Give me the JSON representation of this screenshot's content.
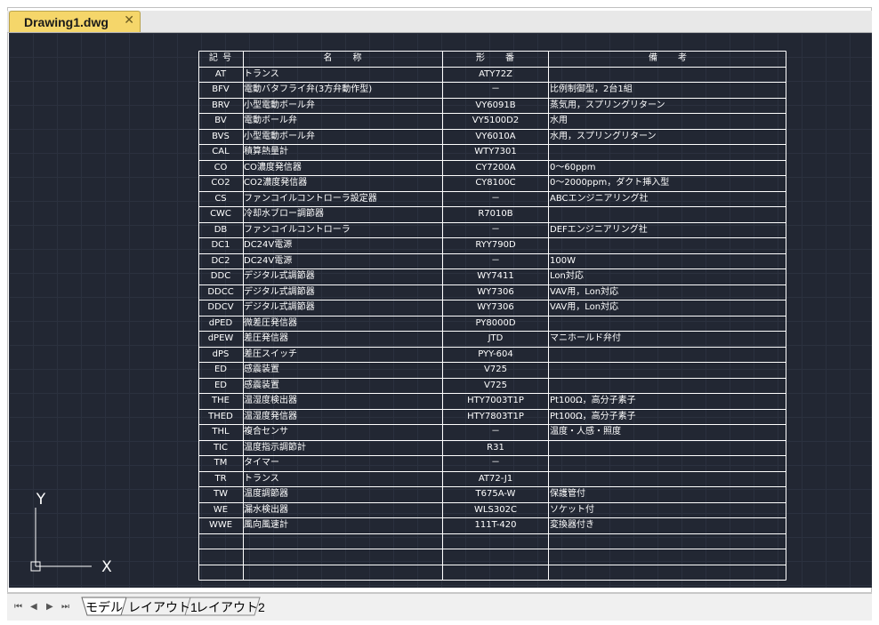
{
  "document_tab": {
    "title": "Drawing1.dwg",
    "close_glyph": "✕"
  },
  "schedule": {
    "headers": {
      "code": "記 号",
      "name": "名　　称",
      "model": "形　　番",
      "note": "備　　考"
    },
    "rows": [
      {
        "code": "AT",
        "name": "トランス",
        "model": "ATY72Z",
        "note": ""
      },
      {
        "code": "BFV",
        "name": "電動バタフライ弁(3方弁動作型)",
        "model": "－",
        "note": "比例制御型，2台1組"
      },
      {
        "code": "BRV",
        "name": "小型電動ボール弁",
        "model": "VY6091B",
        "note": "蒸気用，スプリングリターン"
      },
      {
        "code": "BV",
        "name": "電動ボール弁",
        "model": "VY5100D2",
        "note": "水用"
      },
      {
        "code": "BVS",
        "name": "小型電動ボール弁",
        "model": "VY6010A",
        "note": "水用，スプリングリターン"
      },
      {
        "code": "CAL",
        "name": "積算熱量計",
        "model": "WTY7301",
        "note": ""
      },
      {
        "code": "CO",
        "name": "CO濃度発信器",
        "model": "CY7200A",
        "note": "0～60ppm"
      },
      {
        "code": "CO2",
        "name": "CO2濃度発信器",
        "model": "CY8100C",
        "note": "0～2000ppm，ダクト挿入型"
      },
      {
        "code": "CS",
        "name": "ファンコイルコントローラ設定器",
        "model": "－",
        "note": "ABCエンジニアリング社"
      },
      {
        "code": "CWC",
        "name": "冷却水ブロー調節器",
        "model": "R7010B",
        "note": ""
      },
      {
        "code": "DB",
        "name": "ファンコイルコントローラ",
        "model": "－",
        "note": "DEFエンジニアリング社"
      },
      {
        "code": "DC1",
        "name": "DC24V電源",
        "model": "RYY790D",
        "note": ""
      },
      {
        "code": "DC2",
        "name": "DC24V電源",
        "model": "－",
        "note": "100W"
      },
      {
        "code": "DDC",
        "name": "デジタル式調節器",
        "model": "WY7411",
        "note": "Lon対応"
      },
      {
        "code": "DDCC",
        "name": "デジタル式調節器",
        "model": "WY7306",
        "note": "VAV用，Lon対応"
      },
      {
        "code": "DDCV",
        "name": "デジタル式調節器",
        "model": "WY7306",
        "note": "VAV用，Lon対応"
      },
      {
        "code": "dPED",
        "name": "微差圧発信器",
        "model": "PY8000D",
        "note": ""
      },
      {
        "code": "dPEW",
        "name": "差圧発信器",
        "model": "JTD",
        "note": "マニホールド弁付"
      },
      {
        "code": "dPS",
        "name": "差圧スイッチ",
        "model": "PYY-604",
        "note": ""
      },
      {
        "code": "ED",
        "name": "感震装置",
        "model": "V725",
        "note": ""
      },
      {
        "code": "ED",
        "name": "感震装置",
        "model": "V725",
        "note": ""
      },
      {
        "code": "THE",
        "name": "温湿度検出器",
        "model": "HTY7003T1P",
        "note": "Pt100Ω，高分子素子"
      },
      {
        "code": "THED",
        "name": "温湿度発信器",
        "model": "HTY7803T1P",
        "note": "Pt100Ω，高分子素子"
      },
      {
        "code": "THL",
        "name": "複合センサ",
        "model": "－",
        "note": "温度・人感・照度"
      },
      {
        "code": "TIC",
        "name": "温度指示調節計",
        "model": "R31",
        "note": ""
      },
      {
        "code": "TM",
        "name": "タイマー",
        "model": "－",
        "note": ""
      },
      {
        "code": "TR",
        "name": "トランス",
        "model": "AT72-J1",
        "note": ""
      },
      {
        "code": "TW",
        "name": "温度調節器",
        "model": "T675A-W",
        "note": "保護管付"
      },
      {
        "code": "WE",
        "name": "漏水検出器",
        "model": "WLS302C",
        "note": "ソケット付"
      },
      {
        "code": "WWE",
        "name": "風向風速計",
        "model": "111T-420",
        "note": "変換器付き"
      },
      {
        "code": "",
        "name": "",
        "model": "",
        "note": ""
      },
      {
        "code": "",
        "name": "",
        "model": "",
        "note": ""
      },
      {
        "code": "",
        "name": "",
        "model": "",
        "note": ""
      }
    ]
  },
  "ucs_icon": {
    "y_label": "Y",
    "x_label": "X"
  },
  "layout_tabs": {
    "model": "モデル",
    "layout1": "レイアウト1",
    "layout2": "レイアウト2"
  },
  "nav_buttons": {
    "first": "⏮",
    "prev": "◀",
    "next": "▶",
    "last": "⏭"
  },
  "colors": {
    "canvas_bg": "#222733",
    "tab_accent": "#f5d66a",
    "line": "#ffffff"
  }
}
